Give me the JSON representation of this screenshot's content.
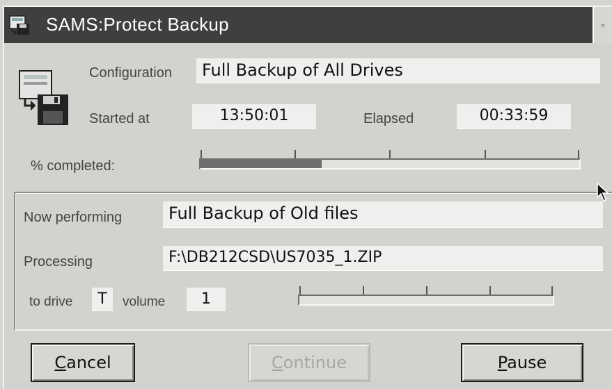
{
  "window": {
    "title": "SAMS:Protect Backup",
    "restore_button_glyph": "▫"
  },
  "summary": {
    "configuration_label": "Configuration",
    "configuration_value": "Full Backup of All Drives",
    "started_label": "Started at",
    "started_value": "13:50:01",
    "elapsed_label": "Elapsed",
    "elapsed_value": "00:33:59",
    "completed_label": "% completed:",
    "overall_progress": 0.32
  },
  "current": {
    "now_performing_label": "Now performing",
    "now_performing_value": "Full Backup of Old files",
    "processing_label": "Processing",
    "processing_value": "F:\\DB212CSD\\US7035_1.ZIP",
    "to_drive_label": "to drive",
    "drive_value": "T",
    "volume_label": "volume",
    "volume_value": "1",
    "volume_progress": 0.0
  },
  "buttons": {
    "cancel": {
      "mnemonic": "C",
      "rest": "ancel"
    },
    "continue": {
      "mnemonic": "C",
      "rest": "ontinue"
    },
    "pause": {
      "mnemonic": "P",
      "rest": "ause"
    }
  },
  "icons": {
    "title": "backup-disk-icon",
    "main": "floppy-backup-icon",
    "pointer": "mouse-pointer-icon"
  }
}
